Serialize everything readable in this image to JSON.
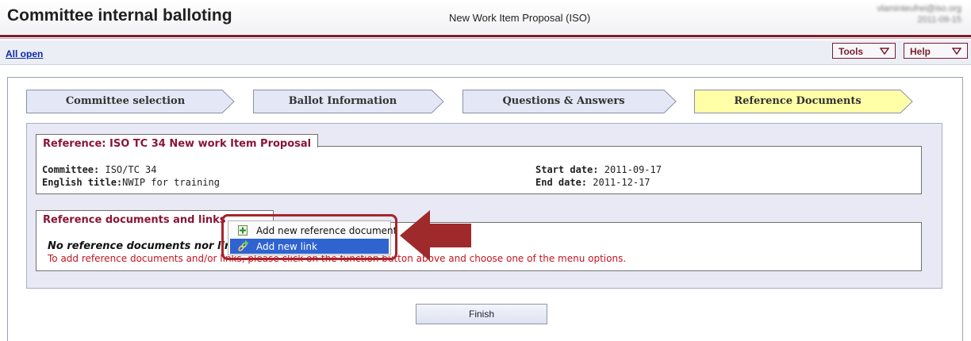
{
  "header": {
    "app_title": "Committee internal balloting",
    "document_title": "New Work Item Proposal (ISO)",
    "user_email": "vlaminteufrei@iso.org",
    "user_date": "2011-09-15"
  },
  "toolbar": {
    "all_open": "All open",
    "tools": "Tools",
    "help": "Help"
  },
  "steps": [
    {
      "label": "Committee selection",
      "active": false
    },
    {
      "label": "Ballot Information",
      "active": false
    },
    {
      "label": "Questions & Answers",
      "active": false
    },
    {
      "label": "Reference Documents",
      "active": true
    }
  ],
  "reference": {
    "title": "Reference: ISO TC 34 New work Item Proposal",
    "committee_label": "Committee:",
    "committee_value": "ISO/TC 34",
    "english_title_label": "English title:",
    "english_title_value": "NWIP for training",
    "start_date_label": "Start date:",
    "start_date_value": "2011-09-17",
    "end_date_label": "End date:",
    "end_date_value": "2011-12-17"
  },
  "ref_docs": {
    "title": "Reference documents and links",
    "empty_title": "No reference documents nor links",
    "empty_hint": "To add reference documents and/or links, please click on the function button above and choose one of the menu options."
  },
  "popup_menu": {
    "items": [
      {
        "label": "Add new reference document",
        "icon": "add-document-icon"
      },
      {
        "label": "Add new link",
        "icon": "add-link-icon"
      }
    ]
  },
  "finish_label": "Finish",
  "colors": {
    "brand_maroon": "#7b1c2c",
    "active_step": "#ffffa8",
    "inactive_step": "#e4e7f6",
    "highlight_red": "#a6252b",
    "hint_red": "#c3141f"
  }
}
